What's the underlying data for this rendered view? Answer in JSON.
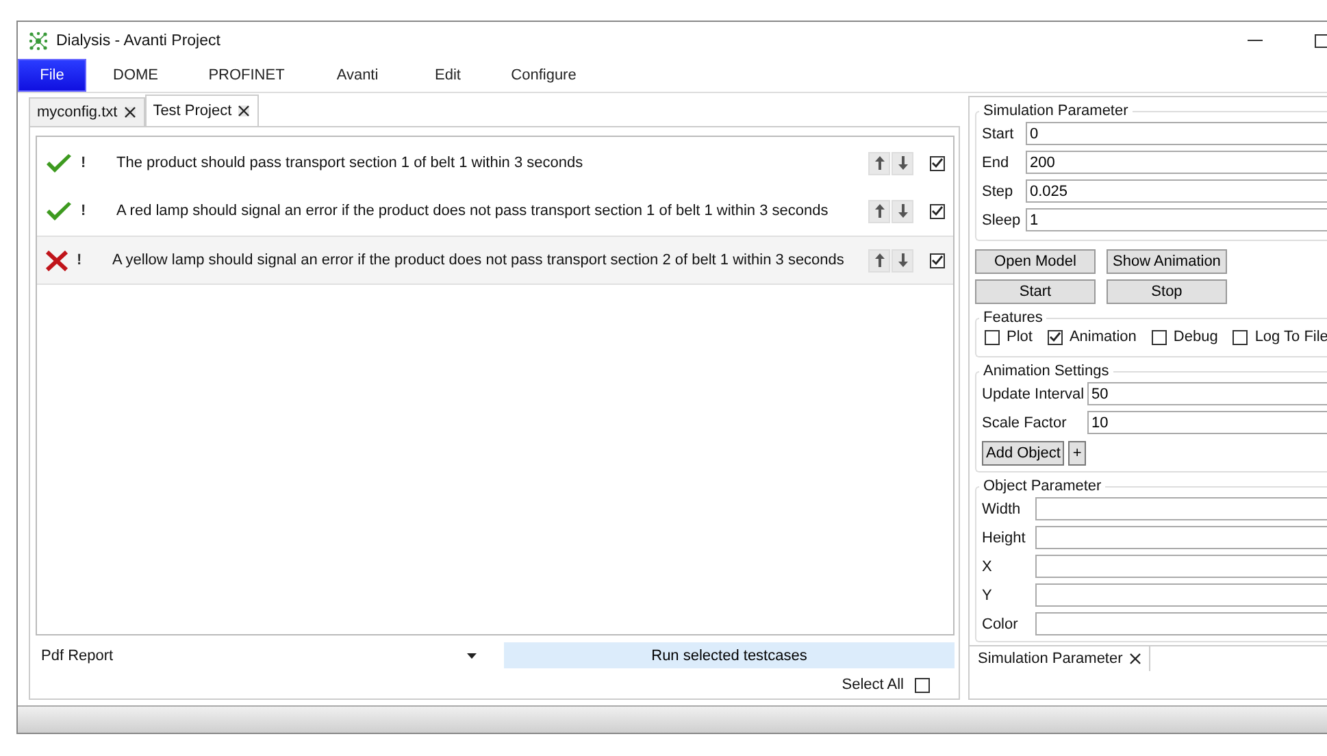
{
  "window": {
    "title": "Dialysis - Avanti Project"
  },
  "menu": [
    {
      "label": "File",
      "selected": true
    },
    {
      "label": "DOME",
      "selected": false
    },
    {
      "label": "PROFINET",
      "selected": false
    },
    {
      "label": "Avanti",
      "selected": false
    },
    {
      "label": "Edit",
      "selected": false
    },
    {
      "label": "Configure",
      "selected": false
    }
  ],
  "tabs": [
    {
      "label": "myconfig.txt",
      "selected": false
    },
    {
      "label": "Test Project",
      "selected": true
    }
  ],
  "testcases": [
    {
      "kind": "pass",
      "mark": "!",
      "text": "The product should pass transport section 1 of belt 1 within 3 seconds",
      "checked": true,
      "selected": false
    },
    {
      "kind": "pass",
      "mark": "!",
      "text": "A red lamp should signal an error if the product does not pass transport section 1 of belt 1 within 3 seconds",
      "checked": true,
      "selected": false
    },
    {
      "kind": "fail",
      "mark": "!",
      "text": "A yellow lamp should signal an error if the product does not pass transport section 2 of belt 1 within 3 seconds",
      "checked": true,
      "selected": true
    }
  ],
  "report": {
    "value": "Pdf Report"
  },
  "run_button": "Run selected testcases",
  "select_all": {
    "label": "Select All",
    "checked": false
  },
  "simulation": {
    "title": "Simulation Parameter",
    "fields": [
      {
        "label": "Start",
        "value": "0"
      },
      {
        "label": "End",
        "value": "200"
      },
      {
        "label": "Step",
        "value": "0.025"
      },
      {
        "label": "Sleep",
        "value": "1"
      }
    ]
  },
  "buttons": [
    [
      "Open Model",
      "Show Animation"
    ],
    [
      "Start",
      "Stop"
    ]
  ],
  "features": {
    "title": "Features",
    "items": [
      {
        "label": "Plot",
        "checked": false
      },
      {
        "label": "Animation",
        "checked": true
      },
      {
        "label": "Debug",
        "checked": false
      },
      {
        "label": "Log To File",
        "checked": false
      }
    ]
  },
  "animation": {
    "title": "Animation Settings",
    "fields": [
      {
        "label": "Update Interval",
        "value": "50"
      },
      {
        "label": "Scale Factor",
        "value": "10"
      }
    ],
    "add_button": "Add Object",
    "plus_button": "+"
  },
  "object": {
    "title": "Object Parameter",
    "fields": [
      {
        "label": "Width"
      },
      {
        "label": "Height"
      },
      {
        "label": "X"
      },
      {
        "label": "Y"
      },
      {
        "label": "Color"
      }
    ]
  },
  "right_tabs": [
    {
      "label": "Simulation Parameter",
      "selected": true
    }
  ]
}
